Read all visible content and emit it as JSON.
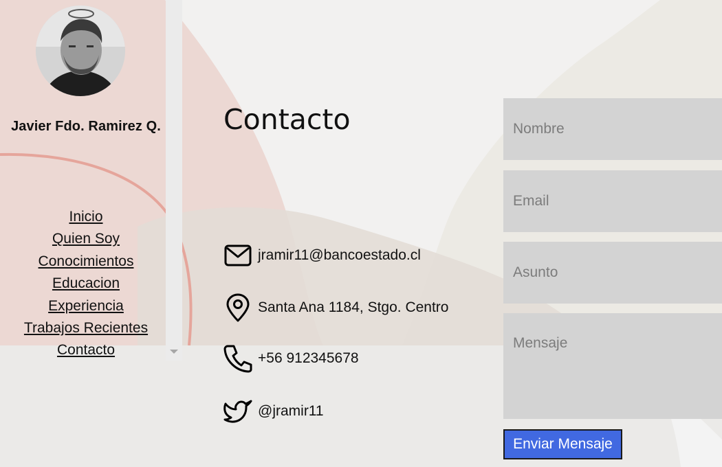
{
  "profile": {
    "name": "Javier Fdo. Ramirez Q."
  },
  "nav": {
    "items": [
      {
        "label": "Inicio"
      },
      {
        "label": "Quien Soy"
      },
      {
        "label": "Conocimientos"
      },
      {
        "label": "Educacion"
      },
      {
        "label": "Experiencia"
      },
      {
        "label": "Trabajos Recientes"
      },
      {
        "label": "Contacto"
      }
    ]
  },
  "contact": {
    "title": "Contacto",
    "email": "jramir11@bancoestado.cl",
    "address": "Santa Ana 1184, Stgo. Centro",
    "phone": "+56 912345678",
    "twitter": "@jramir11"
  },
  "form": {
    "nombre_placeholder": "Nombre",
    "email_placeholder": "Email",
    "asunto_placeholder": "Asunto",
    "mensaje_placeholder": "Mensaje",
    "submit_label": "Enviar Mensaje"
  },
  "colors": {
    "accent": "#4169e1",
    "field_bg": "#d3d3d3",
    "decor_pink": "#e8ccc6",
    "decor_beige": "#e4ded3"
  },
  "icons": {
    "email": "envelope-icon",
    "address": "map-pin-icon",
    "phone": "phone-icon",
    "twitter": "twitter-icon"
  }
}
